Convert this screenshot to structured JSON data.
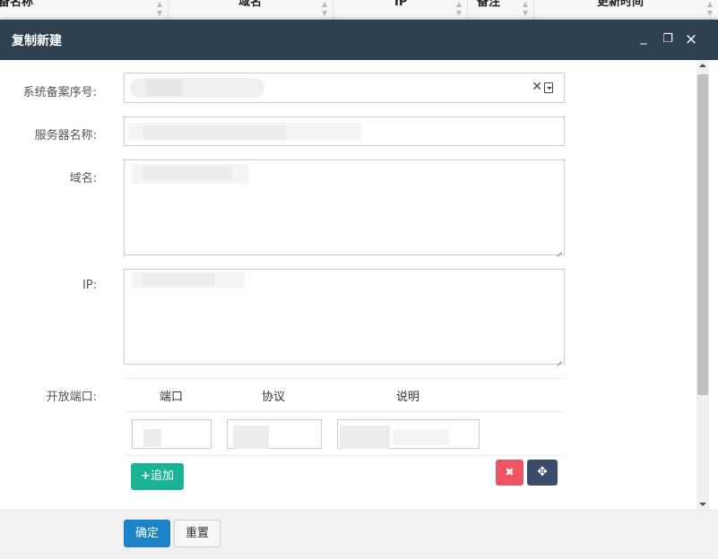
{
  "background_table": {
    "columns": [
      "备名称",
      "域名",
      "IP",
      "备注",
      "更新时间"
    ]
  },
  "dialog": {
    "title": "复制新建",
    "controls": {
      "minimize": "_",
      "maximize": "❐",
      "close": "×"
    }
  },
  "form": {
    "system_record_label": "系统备案序号:",
    "server_name_label": "服务器名称:",
    "domain_label": "域名:",
    "ip_label": "IP:",
    "ports_label": "开放端口:",
    "ports_table": {
      "headers": [
        "端口",
        "协议",
        "说明"
      ]
    },
    "add_button": "追加",
    "delete_icon": "✖",
    "move_icon": "✥"
  },
  "footer": {
    "confirm": "确定",
    "reset": "重置"
  },
  "colors": {
    "titlebar": "#2f4050",
    "confirm": "#1c84c6",
    "add": "#1ab394",
    "delete": "#ed5565",
    "move": "#3b4b6b"
  }
}
